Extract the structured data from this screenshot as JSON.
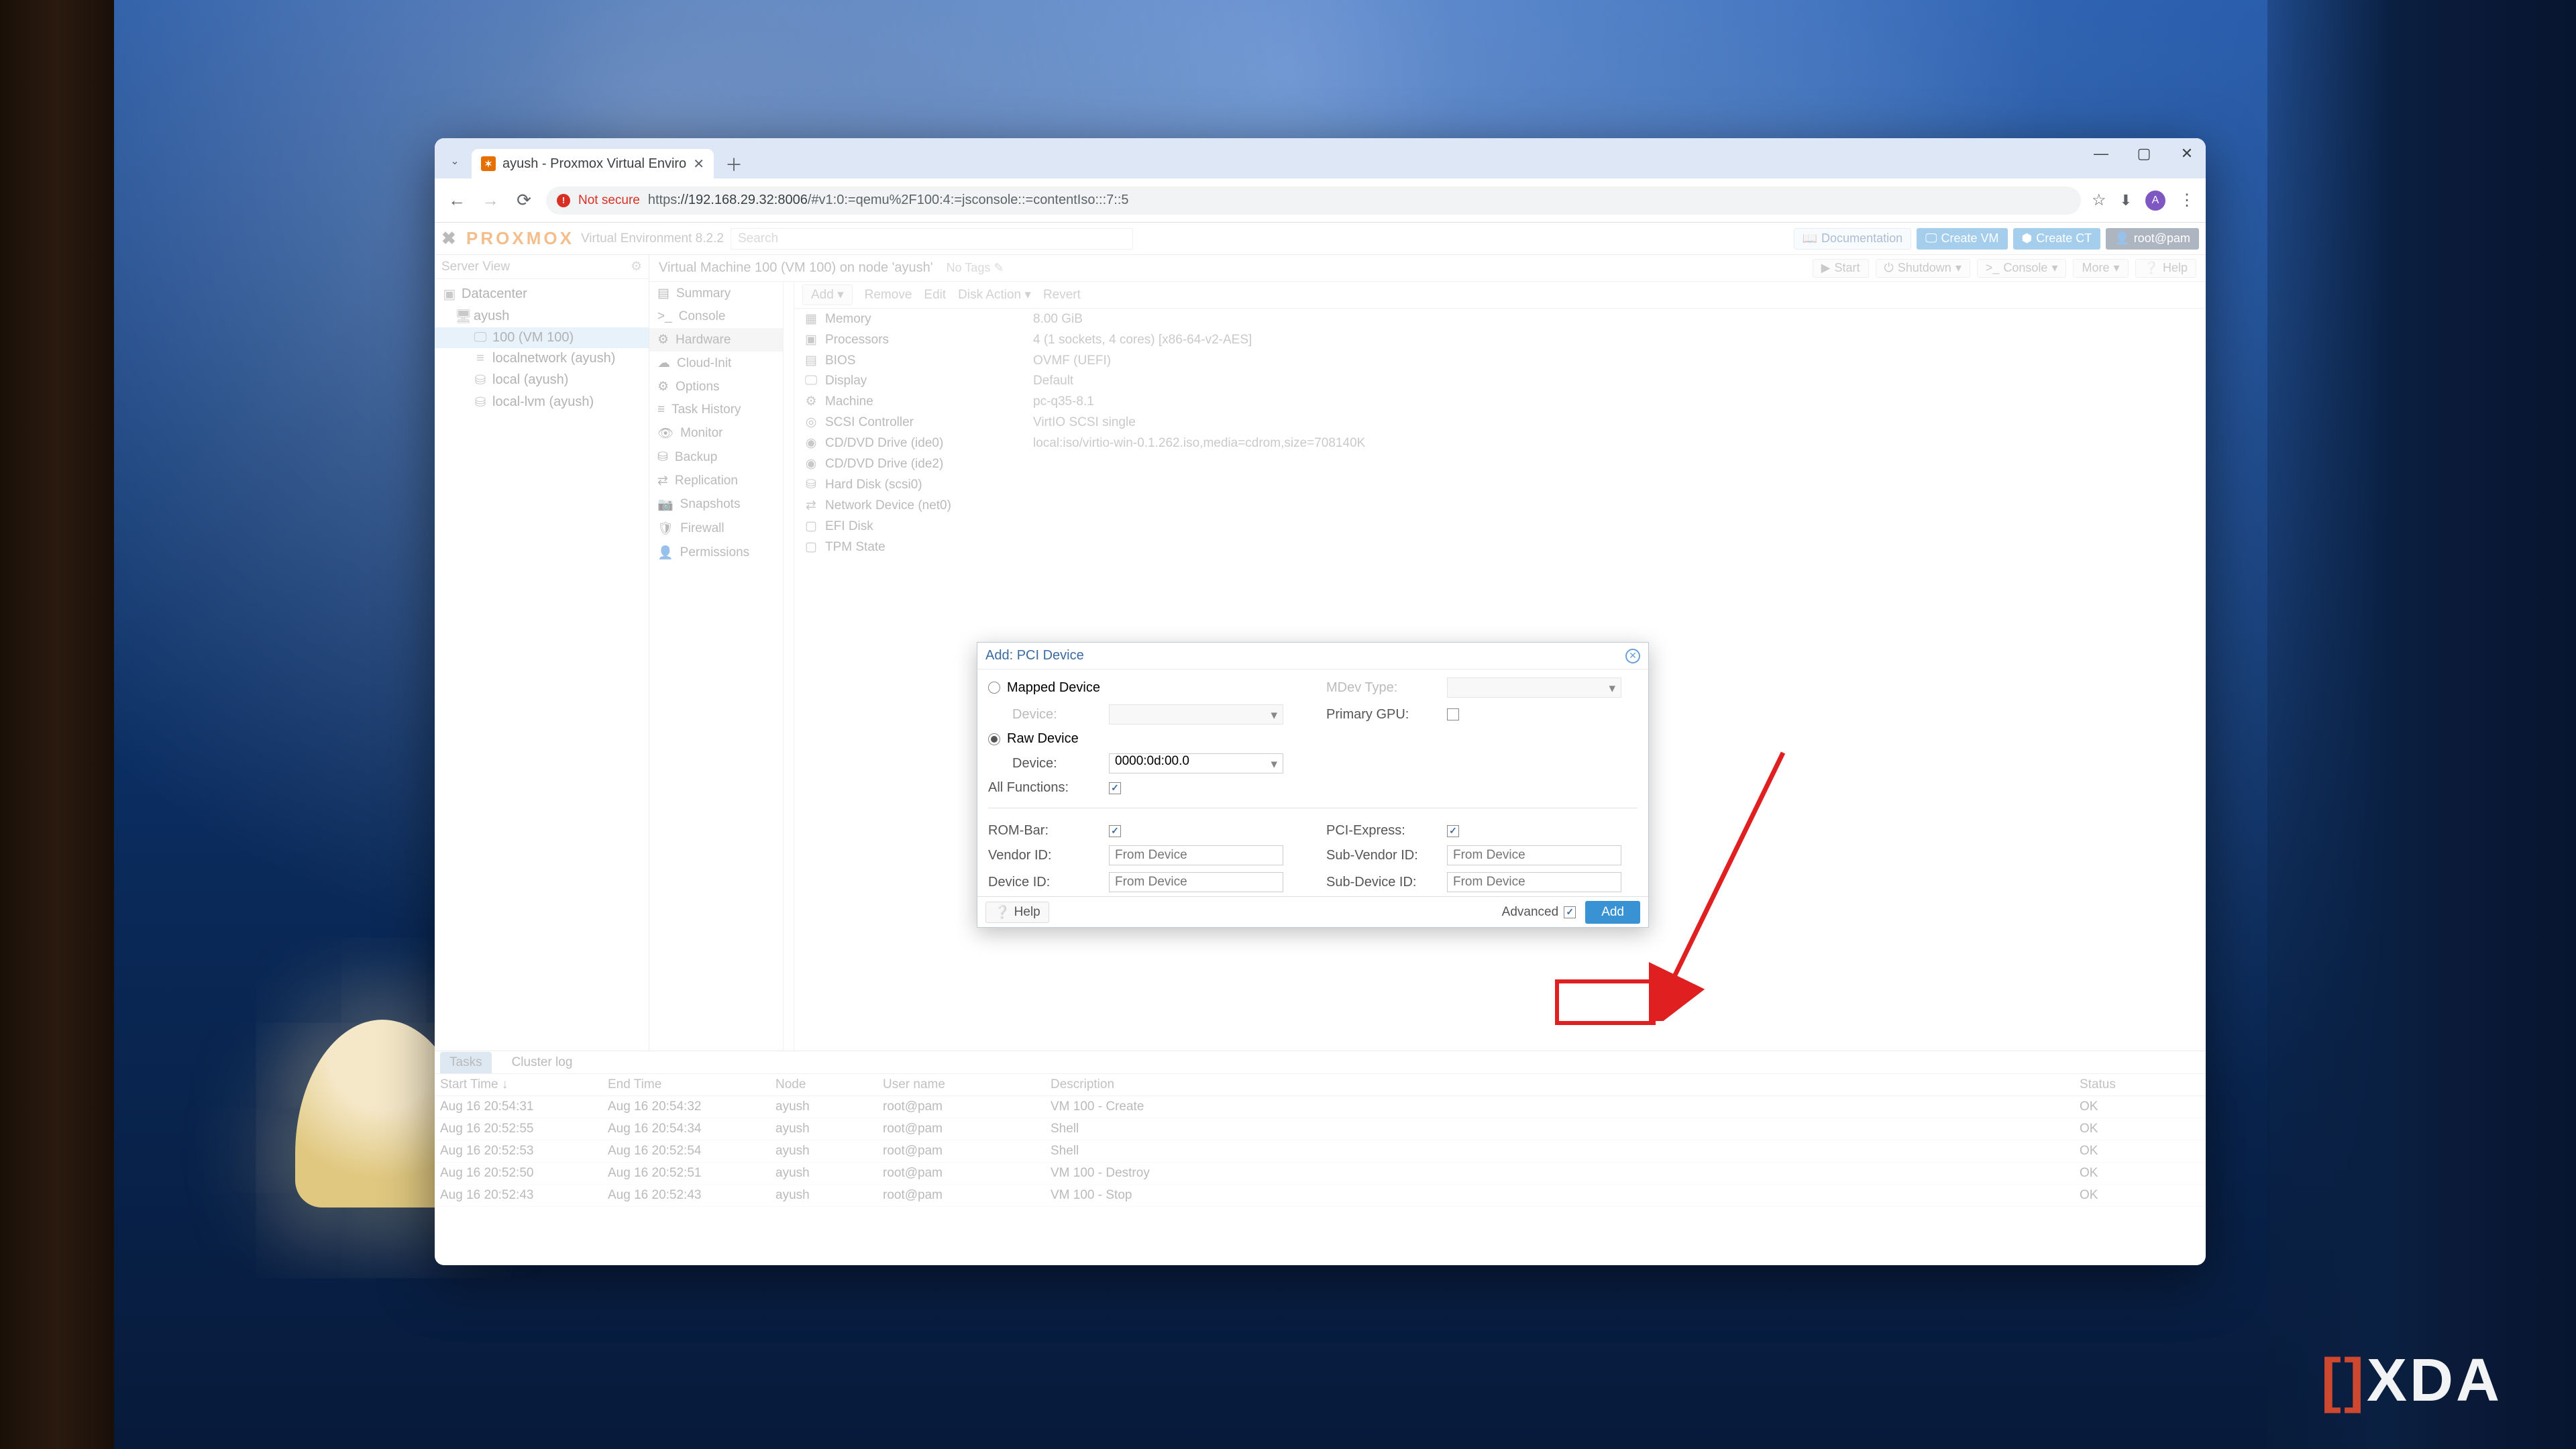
{
  "browser": {
    "tab_title": "ayush - Proxmox Virtual Enviro",
    "not_secure": "Not secure",
    "url_scheme": "https",
    "url_host": "://192.168.29.32:8006",
    "url_path": "/#v1:0:=qemu%2F100:4:=jsconsole::=contentIso:::7::5",
    "avatar_initial": "A"
  },
  "proxmox": {
    "logo": "PROXMOX",
    "version_label": "Virtual Environment 8.2.2",
    "search_placeholder": "Search",
    "header_buttons": {
      "documentation": "Documentation",
      "create_vm": "Create VM",
      "create_ct": "Create CT",
      "user": "root@pam"
    },
    "server_view": "Server View",
    "tree": {
      "datacenter": "Datacenter",
      "node": "ayush",
      "vm": "100 (VM 100)",
      "localnetwork": "localnetwork (ayush)",
      "local": "local (ayush)",
      "locallvm": "local-lvm (ayush)"
    },
    "crumb": "Virtual Machine 100 (VM 100) on node 'ayush'",
    "no_tags": "No Tags",
    "vm_actions": {
      "start": "Start",
      "shutdown": "Shutdown",
      "console": "Console",
      "more": "More",
      "help": "Help"
    },
    "nav2": [
      "Summary",
      "Console",
      "Hardware",
      "Cloud-Init",
      "Options",
      "Task History",
      "Monitor",
      "Backup",
      "Replication",
      "Snapshots",
      "Firewall",
      "Permissions"
    ],
    "nav2_active_index": 2,
    "toolbar": {
      "add": "Add",
      "remove": "Remove",
      "edit": "Edit",
      "disk_action": "Disk Action",
      "revert": "Revert"
    },
    "hardware": [
      {
        "icon": "▦",
        "k": "Memory",
        "v": "8.00 GiB"
      },
      {
        "icon": "▣",
        "k": "Processors",
        "v": "4 (1 sockets, 4 cores) [x86-64-v2-AES]"
      },
      {
        "icon": "▤",
        "k": "BIOS",
        "v": "OVMF (UEFI)"
      },
      {
        "icon": "🖵",
        "k": "Display",
        "v": "Default"
      },
      {
        "icon": "⚙",
        "k": "Machine",
        "v": "pc-q35-8.1"
      },
      {
        "icon": "◎",
        "k": "SCSI Controller",
        "v": "VirtIO SCSI single"
      },
      {
        "icon": "◉",
        "k": "CD/DVD Drive (ide0)",
        "v": "local:iso/virtio-win-0.1.262.iso,media=cdrom,size=708140K"
      },
      {
        "icon": "◉",
        "k": "CD/DVD Drive (ide2)",
        "v": ""
      },
      {
        "icon": "⛁",
        "k": "Hard Disk (scsi0)",
        "v": ""
      },
      {
        "icon": "⇄",
        "k": "Network Device (net0)",
        "v": ""
      },
      {
        "icon": "▢",
        "k": "EFI Disk",
        "v": ""
      },
      {
        "icon": "▢",
        "k": "TPM State",
        "v": ""
      }
    ]
  },
  "modal": {
    "title": "Add: PCI Device",
    "mapped_device": "Mapped Device",
    "raw_device": "Raw Device",
    "device_label": "Device:",
    "device_value": "0000:0d:00.0",
    "all_functions": "All Functions:",
    "mdev_type": "MDev Type:",
    "primary_gpu": "Primary GPU:",
    "rom_bar": "ROM-Bar:",
    "pci_express": "PCI-Express:",
    "vendor_id": "Vendor ID:",
    "device_id": "Device ID:",
    "sub_vendor_id": "Sub-Vendor ID:",
    "sub_device_id": "Sub-Device ID:",
    "from_device": "From Device",
    "help": "Help",
    "advanced": "Advanced",
    "add": "Add"
  },
  "tasks": {
    "tab_tasks": "Tasks",
    "tab_cluster": "Cluster log",
    "headers": {
      "start": "Start Time ↓",
      "end": "End Time",
      "node": "Node",
      "user": "User name",
      "desc": "Description",
      "status": "Status"
    },
    "rows": [
      {
        "start": "Aug 16 20:54:31",
        "end": "Aug 16 20:54:32",
        "node": "ayush",
        "user": "root@pam",
        "desc": "VM 100 - Create",
        "status": "OK"
      },
      {
        "start": "Aug 16 20:52:55",
        "end": "Aug 16 20:54:34",
        "node": "ayush",
        "user": "root@pam",
        "desc": "Shell",
        "status": "OK"
      },
      {
        "start": "Aug 16 20:52:53",
        "end": "Aug 16 20:52:54",
        "node": "ayush",
        "user": "root@pam",
        "desc": "Shell",
        "status": "OK"
      },
      {
        "start": "Aug 16 20:52:50",
        "end": "Aug 16 20:52:51",
        "node": "ayush",
        "user": "root@pam",
        "desc": "VM 100 - Destroy",
        "status": "OK"
      },
      {
        "start": "Aug 16 20:52:43",
        "end": "Aug 16 20:52:43",
        "node": "ayush",
        "user": "root@pam",
        "desc": "VM 100 - Stop",
        "status": "OK"
      }
    ]
  },
  "watermark": "XDA"
}
